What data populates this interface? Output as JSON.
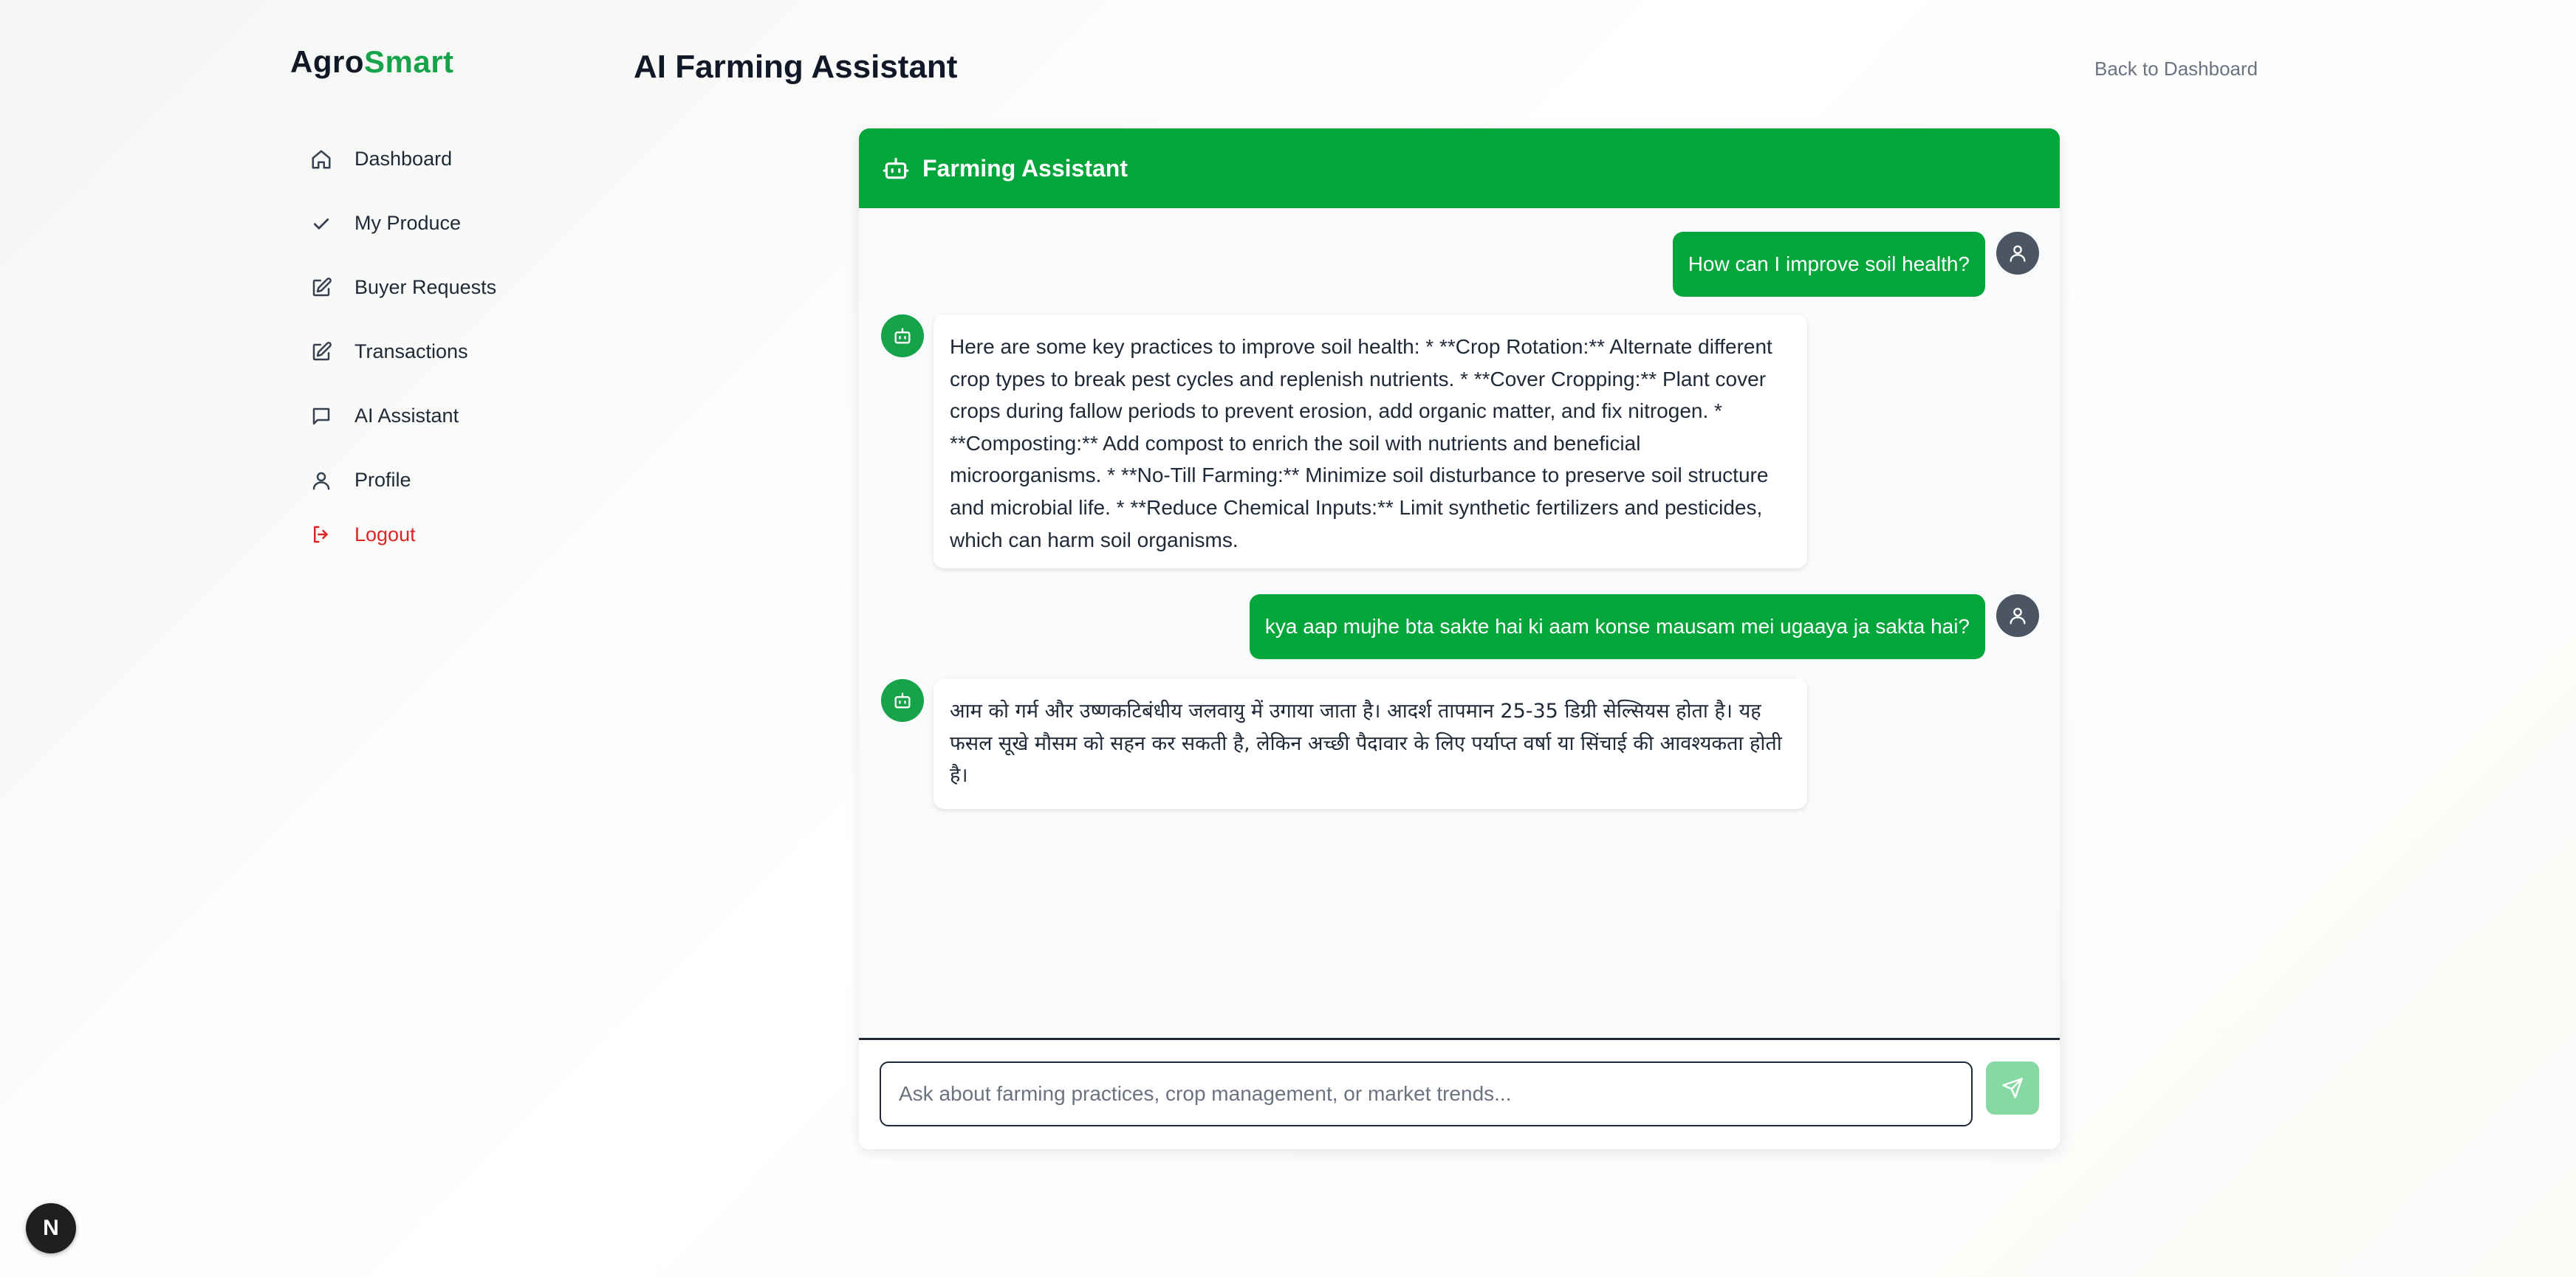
{
  "brand": {
    "part1": "Agro",
    "part2": "Smart",
    "accent_color": "#16a34a"
  },
  "header": {
    "title": "AI Farming Assistant",
    "back_link": "Back to Dashboard"
  },
  "sidebar": {
    "items": [
      {
        "label": "Dashboard",
        "icon": "home-icon"
      },
      {
        "label": "My Produce",
        "icon": "check-icon"
      },
      {
        "label": "Buyer Requests",
        "icon": "edit-icon"
      },
      {
        "label": "Transactions",
        "icon": "edit-icon"
      },
      {
        "label": "AI Assistant",
        "icon": "chat-icon"
      },
      {
        "label": "Profile",
        "icon": "user-icon"
      },
      {
        "label": "Logout",
        "icon": "logout-icon",
        "color": "#dc2626"
      }
    ]
  },
  "chat": {
    "title": "Farming Assistant",
    "header_color": "#02a63b",
    "messages": [
      {
        "role": "user",
        "text": "How can I improve soil health?"
      },
      {
        "role": "assistant",
        "text": "Here are some key practices to improve soil health: * **Crop Rotation:** Alternate different crop types to break pest cycles and replenish nutrients. * **Cover Cropping:** Plant cover crops during fallow periods to prevent erosion, add organic matter, and fix nitrogen. * **Composting:** Add compost to enrich the soil with nutrients and beneficial microorganisms. * **No-Till Farming:** Minimize soil disturbance to preserve soil structure and microbial life. * **Reduce Chemical Inputs:** Limit synthetic fertilizers and pesticides, which can harm soil organisms."
      },
      {
        "role": "user",
        "text": "kya aap mujhe bta sakte hai ki aam konse mausam mei ugaaya ja sakta hai?"
      },
      {
        "role": "assistant",
        "text": "आम को गर्म और उष्णकटिबंधीय जलवायु में उगाया जाता है। आदर्श तापमान 25-35 डिग्री सेल्सियस होता है। यह फसल सूखे मौसम को सहन कर सकती है, लेकिन अच्छी पैदावार के लिए पर्याप्त वर्षा या सिंचाई की आवश्यकता होती है।"
      }
    ],
    "input_placeholder": "Ask about farming practices, crop management, or market trends..."
  },
  "dev_badge": {
    "label": "N"
  }
}
